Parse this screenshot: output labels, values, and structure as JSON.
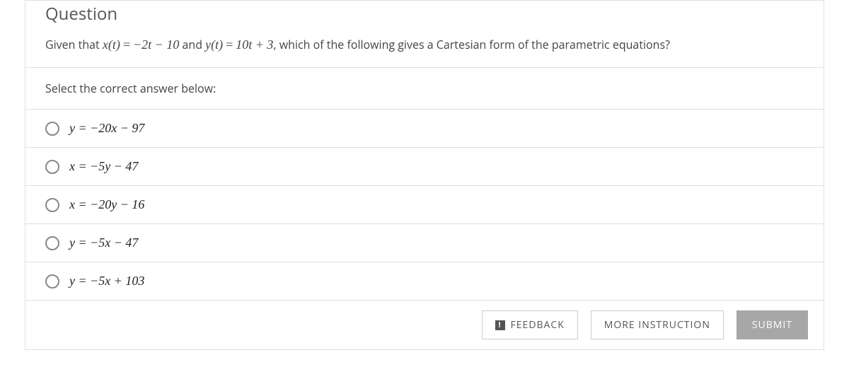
{
  "question": {
    "title": "Question",
    "prompt_pre": "Given that ",
    "eq1_lhs": "x(t)",
    "eq1_rhs": "−2t − 10",
    "prompt_mid": " and ",
    "eq2_lhs": "y(t)",
    "eq2_rhs": "10t + 3",
    "prompt_post": ", which of the following gives a Cartesian form of the parametric equations?"
  },
  "instruction": "Select the correct answer below:",
  "options": [
    {
      "text": "y = −20x − 97"
    },
    {
      "text": "x = −5y − 47"
    },
    {
      "text": "x = −20y − 16"
    },
    {
      "text": "y = −5x − 47"
    },
    {
      "text": "y = −5x + 103"
    }
  ],
  "buttons": {
    "feedback": "FEEDBACK",
    "more": "MORE INSTRUCTION",
    "submit": "SUBMIT"
  }
}
